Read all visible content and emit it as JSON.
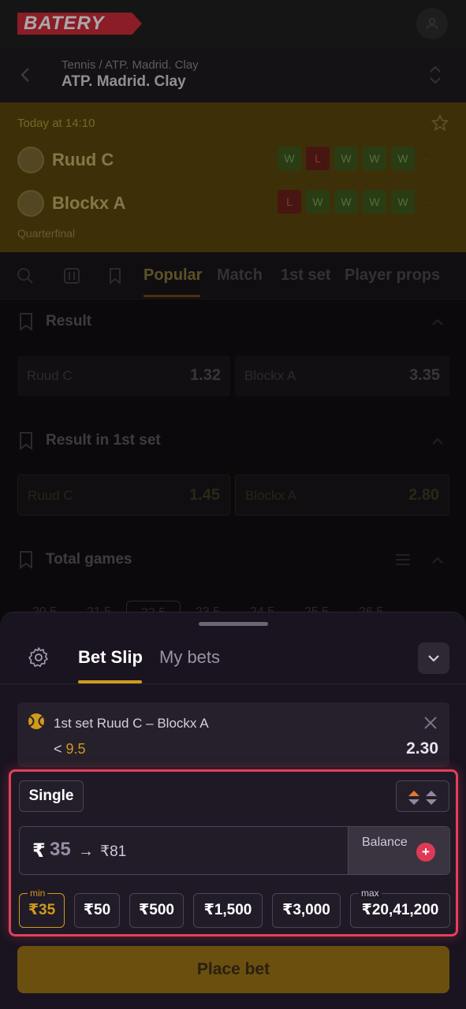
{
  "app": {
    "logo_text": "BATERY"
  },
  "header": {
    "breadcrumb": "Tennis / ATP. Madrid. Clay",
    "title": "ATP. Madrid. Clay"
  },
  "match": {
    "time": "Today at 14:10",
    "players": [
      {
        "name": "Ruud C",
        "form": [
          "W",
          "L",
          "W",
          "W",
          "W",
          "-"
        ]
      },
      {
        "name": "Blockx A",
        "form": [
          "L",
          "W",
          "W",
          "W",
          "W",
          "-"
        ]
      }
    ],
    "stage": "Quarterfinal"
  },
  "market_tabs": [
    "Popular",
    "Match",
    "1st set",
    "Player props"
  ],
  "markets": [
    {
      "title": "Result",
      "outcomes": [
        {
          "name": "Ruud C",
          "odds": "1.32"
        },
        {
          "name": "Blockx A",
          "odds": "3.35"
        }
      ]
    },
    {
      "title": "Result in 1st set",
      "outcomes": [
        {
          "name": "Ruud C",
          "odds": "1.45"
        },
        {
          "name": "Blockx A",
          "odds": "2.80"
        }
      ]
    },
    {
      "title": "Total games",
      "lines": [
        "20.5",
        "21.5",
        "22.5",
        "23.5",
        "24.5",
        "25.5",
        "26.5"
      ]
    }
  ],
  "bet_slip": {
    "tabs": {
      "active": "Bet Slip",
      "inactive": "My bets"
    },
    "item": {
      "event": "1st set Ruud C – Blockx A",
      "market_prefix": "<",
      "market_line": "9.5",
      "odds": "2.30"
    },
    "bet_type": "Single",
    "stake": {
      "currency": "₹",
      "value": "35",
      "arrow": "→",
      "potential_win": "₹81",
      "balance_label": "Balance",
      "balance_plus": "+"
    },
    "quick_stakes": [
      {
        "label": "₹35",
        "tag": "min",
        "selected": true
      },
      {
        "label": "₹50",
        "tag": ""
      },
      {
        "label": "₹500",
        "tag": ""
      },
      {
        "label": "₹1,500",
        "tag": ""
      },
      {
        "label": "₹3,000",
        "tag": ""
      },
      {
        "label": "₹20,41,200",
        "tag": "max"
      }
    ],
    "place_bet_label": "Place bet"
  },
  "colors": {
    "accent": "#d09a1c",
    "highlight": "#e3405a",
    "sheet_bg": "#1a1420"
  }
}
